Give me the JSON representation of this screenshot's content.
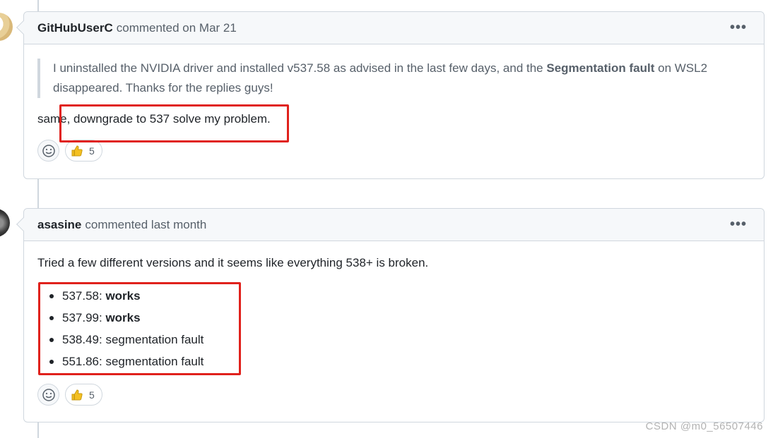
{
  "comments": [
    {
      "author": "GitHubUserC",
      "meta": "commented on Mar 21",
      "quote_before": "I uninstalled the NVIDIA driver and installed v537.58 as advised in the last few days, and the ",
      "quote_bold": "Segmentation fault",
      "quote_after": " on WSL2 disappeared. Thanks for the replies guys!",
      "body": "same, downgrade to 537 solve my problem.",
      "reaction_count": "5"
    },
    {
      "author": "asasine",
      "meta": "commented last month",
      "body": "Tried a few different versions and it seems like everything 538+ is broken.",
      "list": [
        {
          "version": "537.58: ",
          "status": "works",
          "bold": true
        },
        {
          "version": "537.99: ",
          "status": "works",
          "bold": true
        },
        {
          "version": "538.49: ",
          "status": "segmentation fault",
          "bold": false
        },
        {
          "version": "551.86: ",
          "status": "segmentation fault",
          "bold": false
        }
      ],
      "reaction_count": "5"
    }
  ],
  "icons": {
    "menu": "kebab-horizontal-icon",
    "add_reaction": "smiley-icon",
    "thumbs_up": "thumbs-up-icon"
  },
  "colors": {
    "highlight": "#e0211c",
    "thumb": "#f4c021"
  },
  "watermark": "CSDN @m0_56507446"
}
